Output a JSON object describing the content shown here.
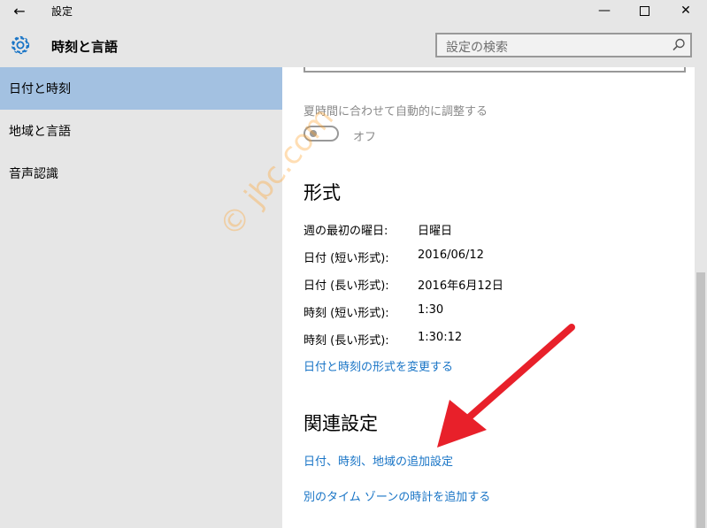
{
  "window": {
    "title": "設定"
  },
  "header": {
    "title": "時刻と言語"
  },
  "search": {
    "placeholder": "設定の検索"
  },
  "sidebar": {
    "items": [
      {
        "label": "日付と時刻",
        "active": true
      },
      {
        "label": "地域と言語",
        "active": false
      },
      {
        "label": "音声認識",
        "active": false
      }
    ]
  },
  "dst": {
    "label": "夏時間に合わせて自動的に調整する",
    "state": "オフ"
  },
  "format": {
    "heading": "形式",
    "rows": [
      {
        "label": "週の最初の曜日:",
        "value": "日曜日"
      },
      {
        "label": "日付 (短い形式):",
        "value": "2016/06/12"
      },
      {
        "label": "日付 (長い形式):",
        "value": "2016年6月12日"
      },
      {
        "label": "時刻 (短い形式):",
        "value": "1:30"
      },
      {
        "label": "時刻 (長い形式):",
        "value": "1:30:12"
      }
    ],
    "change_link": "日付と時刻の形式を変更する"
  },
  "related": {
    "heading": "関連設定",
    "links": [
      "日付、時刻、地域の追加設定",
      "別のタイム ゾーンの時計を追加する"
    ]
  },
  "watermark": "© jbc.com",
  "colors": {
    "accent": "#1874c6",
    "selected": "#a3c1e1",
    "arrow": "#e8202a",
    "watermark": "#ffa028"
  }
}
